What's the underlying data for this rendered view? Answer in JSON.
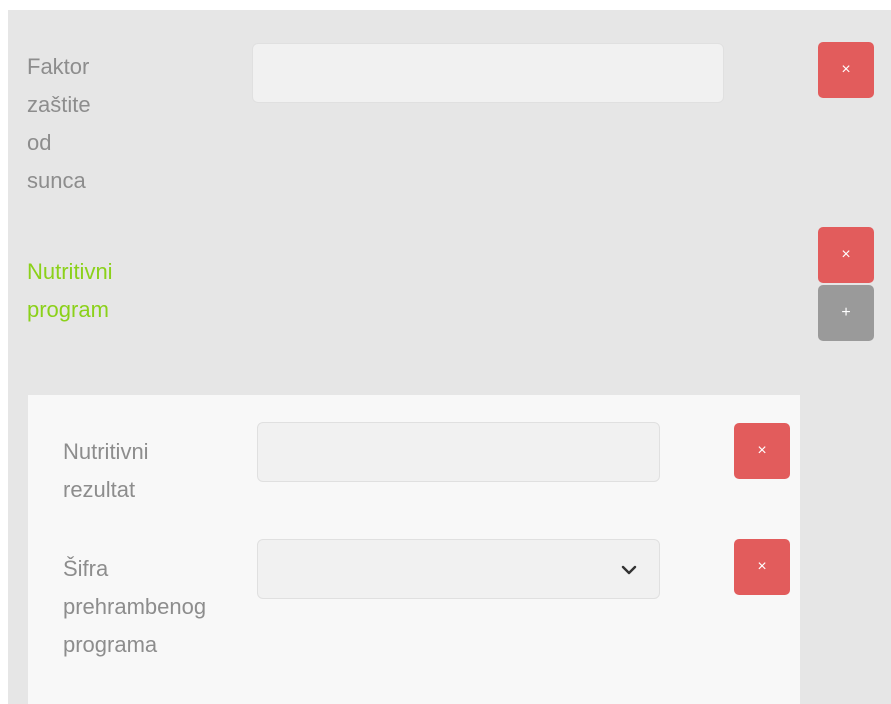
{
  "form": {
    "spf": {
      "label_lines": [
        "Faktor",
        "zaštite",
        "od",
        "sunca"
      ],
      "value": "",
      "remove_label": "×"
    },
    "nutrition_program": {
      "label_lines": [
        "Nutritivni",
        "program"
      ],
      "remove_label": "×",
      "add_label": "+",
      "accent_color": "#8bd11a",
      "result": {
        "label_lines": [
          "Nutritivni",
          "rezultat"
        ],
        "value": "",
        "remove_label": "×"
      },
      "program_code": {
        "label_lines": [
          "Šifra",
          "prehrambenog",
          "programa"
        ],
        "selected": "",
        "remove_label": "×"
      }
    }
  },
  "colors": {
    "remove_button": "#e25c5c",
    "add_button": "#9a9a9a",
    "label": "#8d8d8d"
  },
  "icons": {
    "remove": "close-icon",
    "add": "plus-icon",
    "select": "chevron-down-icon"
  }
}
